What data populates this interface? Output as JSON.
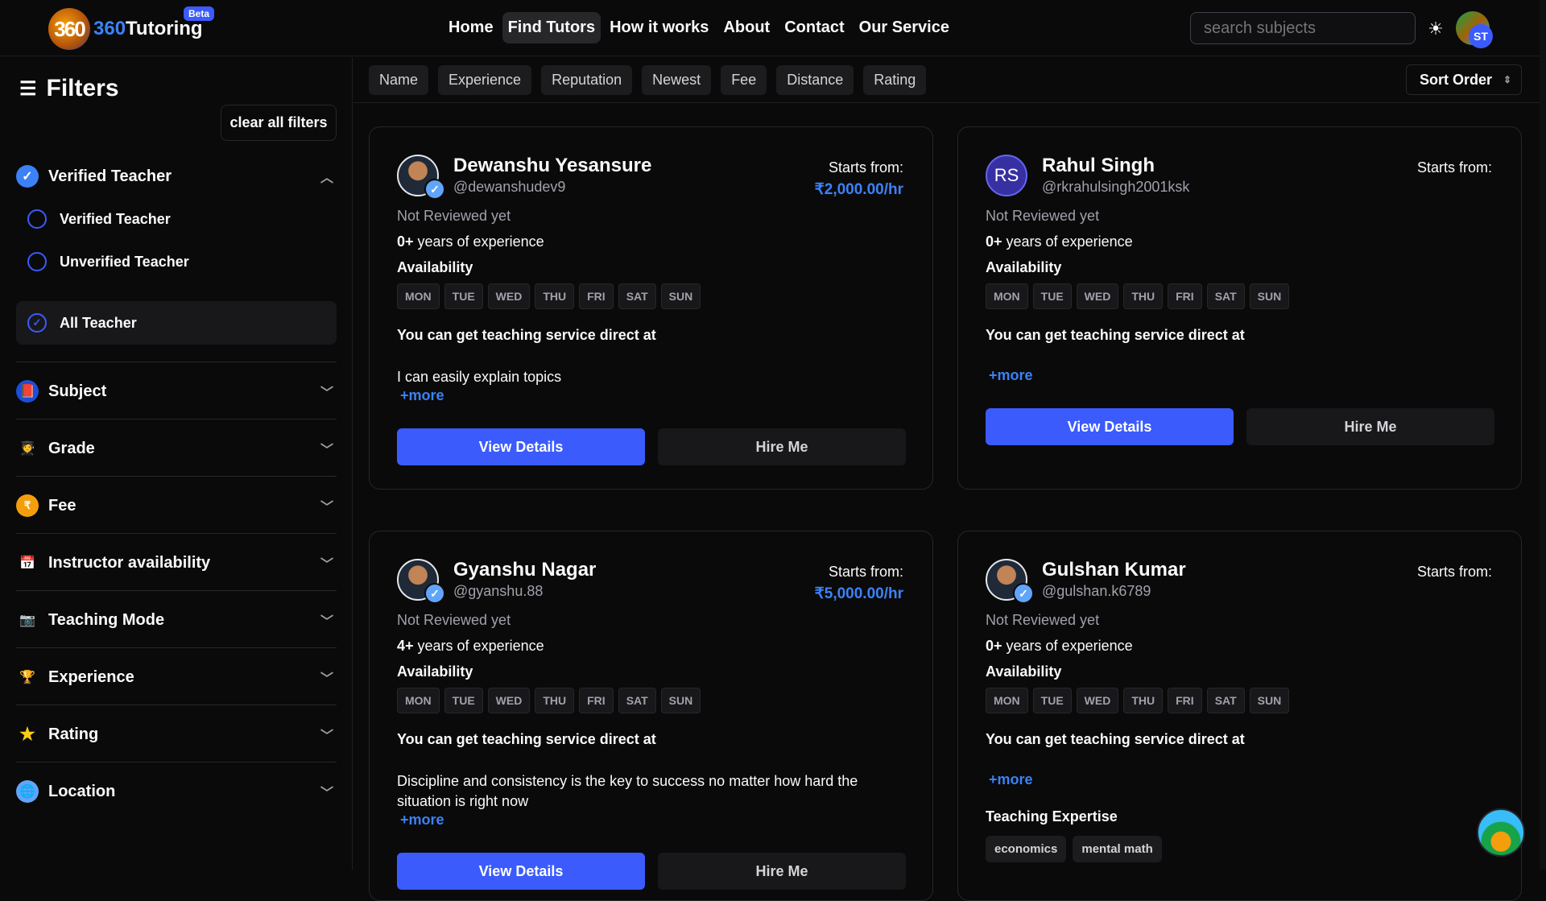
{
  "header": {
    "logo_mark": "360",
    "logo_prefix": "360",
    "logo_name": "Tutoring",
    "beta": "Beta",
    "nav": [
      "Home",
      "Find Tutors",
      "How it works",
      "About",
      "Contact",
      "Our Service"
    ],
    "active_nav": "Find Tutors",
    "search_placeholder": "search subjects",
    "avatar_initials": "ST",
    "theme_icon": "sun-icon"
  },
  "sidebar": {
    "title": "Filters",
    "clear_label": "clear all filters",
    "verified_section": "Verified Teacher",
    "options": [
      "Verified Teacher",
      "Unverified Teacher",
      "All Teacher"
    ],
    "selected_option": "All Teacher",
    "sections": [
      "Subject",
      "Grade",
      "Fee",
      "Instructor availability",
      "Teaching Mode",
      "Experience",
      "Rating",
      "Location"
    ]
  },
  "sort": {
    "chips": [
      "Name",
      "Experience",
      "Reputation",
      "Newest",
      "Fee",
      "Distance",
      "Rating"
    ],
    "order_label": "Sort Order"
  },
  "labels": {
    "starts_from": "Starts from:",
    "availability": "Availability",
    "service": "You can get teaching service direct at",
    "more": "+more",
    "view_details": "View Details",
    "hire_me": "Hire Me",
    "years_suffix": " years of experience",
    "teaching_expertise": "Teaching Expertise",
    "days": [
      "MON",
      "TUE",
      "WED",
      "THU",
      "FRI",
      "SAT",
      "SUN"
    ]
  },
  "tutors": [
    {
      "name": "Dewanshu Yesansure",
      "handle": "@dewanshudev9",
      "review": "Not Reviewed yet",
      "experience": "0+",
      "price": "₹2,000.00/hr",
      "bio": "I can easily explain topics"
    },
    {
      "name": "Rahul Singh",
      "handle": "@rkrahulsingh2001ksk",
      "initials": "RS",
      "review": "Not Reviewed yet",
      "experience": "0+",
      "price": "",
      "bio": ""
    },
    {
      "name": "Gyanshu Nagar",
      "handle": "@gyanshu.88",
      "review": "Not Reviewed yet",
      "experience": "4+",
      "price": "₹5,000.00/hr",
      "bio": "Discipline and consistency is the key to success no matter how hard the situation is right now"
    },
    {
      "name": "Gulshan Kumar",
      "handle": "@gulshan.k6789",
      "review": "Not Reviewed yet",
      "experience": "0+",
      "price": "",
      "bio": "",
      "expertise": [
        "economics",
        "mental math"
      ]
    }
  ],
  "colors": {
    "accent": "#3b5bfd",
    "price": "#3b82f6",
    "background": "#0a0a0b"
  }
}
